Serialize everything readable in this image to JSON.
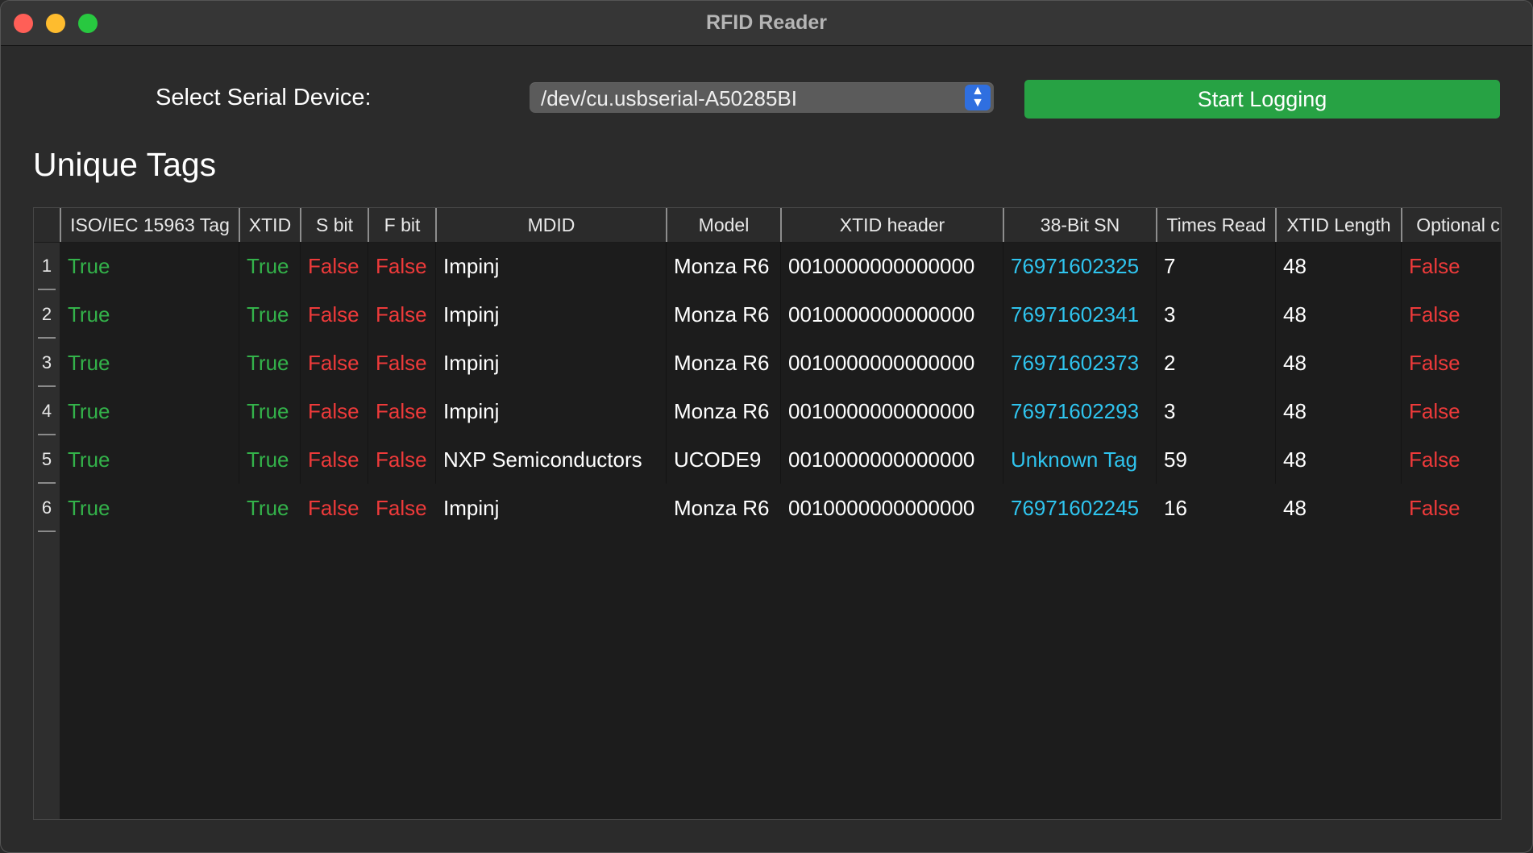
{
  "window": {
    "title": "RFID Reader"
  },
  "controls": {
    "device_label": "Select Serial Device:",
    "device_value": "/dev/cu.usbserial-A50285BI",
    "start_label": "Start Logging"
  },
  "section": {
    "heading": "Unique Tags"
  },
  "colors": {
    "true": "#33b24a",
    "false": "#ee3a3a",
    "sn": "#2fc4ee",
    "button": "#27a244"
  },
  "table": {
    "headers": [
      "ISO/IEC 15963 Tag",
      "XTID",
      "S bit",
      "F bit",
      "MDID",
      "Model",
      "XTID header",
      "38-Bit SN",
      "Times Read",
      "XTID Length",
      "Optional c"
    ],
    "rows": [
      {
        "num": "1",
        "iso": "True",
        "xtid": "True",
        "sbit": "False",
        "fbit": "False",
        "mdid": "Impinj",
        "model": "Monza R6",
        "header": "0010000000000000",
        "sn": "76971602325",
        "times": "7",
        "length": "48",
        "optional": "False"
      },
      {
        "num": "2",
        "iso": "True",
        "xtid": "True",
        "sbit": "False",
        "fbit": "False",
        "mdid": "Impinj",
        "model": "Monza R6",
        "header": "0010000000000000",
        "sn": "76971602341",
        "times": "3",
        "length": "48",
        "optional": "False"
      },
      {
        "num": "3",
        "iso": "True",
        "xtid": "True",
        "sbit": "False",
        "fbit": "False",
        "mdid": "Impinj",
        "model": "Monza R6",
        "header": "0010000000000000",
        "sn": "76971602373",
        "times": "2",
        "length": "48",
        "optional": "False"
      },
      {
        "num": "4",
        "iso": "True",
        "xtid": "True",
        "sbit": "False",
        "fbit": "False",
        "mdid": "Impinj",
        "model": "Monza R6",
        "header": "0010000000000000",
        "sn": "76971602293",
        "times": "3",
        "length": "48",
        "optional": "False"
      },
      {
        "num": "5",
        "iso": "True",
        "xtid": "True",
        "sbit": "False",
        "fbit": "False",
        "mdid": "NXP Semiconductors",
        "model": "UCODE9",
        "header": "0010000000000000",
        "sn": "Unknown Tag",
        "times": "59",
        "length": "48",
        "optional": "False"
      },
      {
        "num": "6",
        "iso": "True",
        "xtid": "True",
        "sbit": "False",
        "fbit": "False",
        "mdid": "Impinj",
        "model": "Monza R6",
        "header": "0010000000000000",
        "sn": "76971602245",
        "times": "16",
        "length": "48",
        "optional": "False"
      }
    ]
  }
}
